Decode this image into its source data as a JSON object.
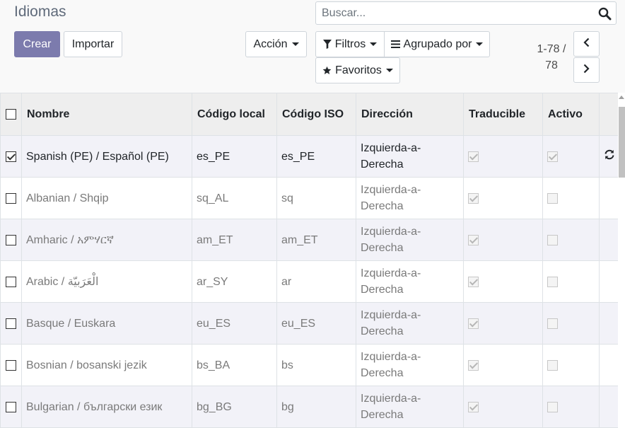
{
  "page": {
    "title": "Idiomas"
  },
  "search": {
    "placeholder": "Buscar..."
  },
  "buttons": {
    "create": "Crear",
    "import": "Importar",
    "action": "Acción",
    "filters": "Filtros",
    "group_by": "Agrupado por",
    "favorites": "Favoritos"
  },
  "pager": {
    "value": "1-78 / 78"
  },
  "table": {
    "columns": [
      "Nombre",
      "Código local",
      "Código ISO",
      "Dirección",
      "Traducible",
      "Activo"
    ],
    "rows": [
      {
        "name": "Spanish (PE) / Español (PE)",
        "code": "es_PE",
        "iso": "es_PE",
        "direction": "Izquierda-a-Derecha",
        "translatable": true,
        "active": true,
        "selected": true
      },
      {
        "name": "Albanian / Shqip",
        "code": "sq_AL",
        "iso": "sq",
        "direction": "Izquierda-a-Derecha",
        "translatable": true,
        "active": false,
        "selected": false
      },
      {
        "name": "Amharic / አምሃርኛ",
        "code": "am_ET",
        "iso": "am_ET",
        "direction": "Izquierda-a-Derecha",
        "translatable": true,
        "active": false,
        "selected": false
      },
      {
        "name": "Arabic / الْعَرَبيّة",
        "code": "ar_SY",
        "iso": "ar",
        "direction": "Izquierda-a-Derecha",
        "translatable": true,
        "active": false,
        "selected": false
      },
      {
        "name": "Basque / Euskara",
        "code": "eu_ES",
        "iso": "eu_ES",
        "direction": "Izquierda-a-Derecha",
        "translatable": true,
        "active": false,
        "selected": false
      },
      {
        "name": "Bosnian / bosanski jezik",
        "code": "bs_BA",
        "iso": "bs",
        "direction": "Izquierda-a-Derecha",
        "translatable": true,
        "active": false,
        "selected": false
      },
      {
        "name": "Bulgarian / български език",
        "code": "bg_BG",
        "iso": "bg",
        "direction": "Izquierda-a-Derecha",
        "translatable": true,
        "active": false,
        "selected": false
      }
    ]
  },
  "colors": {
    "primary": "#7c7bad",
    "row_alt": "#f2f2f8",
    "header_bg": "#eeeeee",
    "panel_bg": "#f9f9f9"
  },
  "icons": {
    "search": "search-icon",
    "filter": "filter-icon",
    "group": "list-icon",
    "favorites": "star-icon",
    "prev": "chevron-left-icon",
    "next": "chevron-right-icon",
    "row_action": "refresh-icon"
  }
}
